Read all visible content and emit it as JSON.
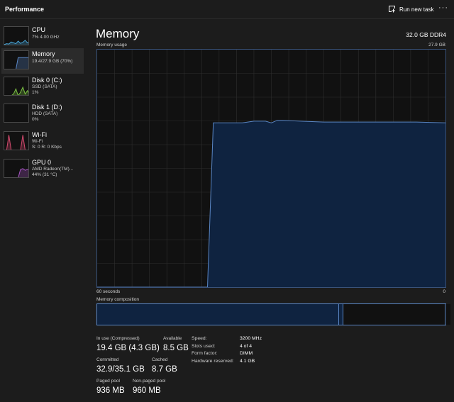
{
  "app": {
    "title": "Performance",
    "run_new_task": "Run new task",
    "more_glyph": "···"
  },
  "sidebar": {
    "items": [
      {
        "id": "cpu",
        "title": "CPU",
        "lines": [
          "7% 4.00 GHz"
        ],
        "color": "#4aa6d8",
        "active": false
      },
      {
        "id": "memory",
        "title": "Memory",
        "lines": [
          "19.4/27.9 GB (70%)"
        ],
        "color": "#5a86c4",
        "active": true
      },
      {
        "id": "disk0",
        "title": "Disk 0 (C:)",
        "lines": [
          "SSD (SATA)",
          "1%"
        ],
        "color": "#7bc043",
        "active": false
      },
      {
        "id": "disk1",
        "title": "Disk 1 (D:)",
        "lines": [
          "HDD (SATA)",
          "0%"
        ],
        "color": "#7bc043",
        "active": false
      },
      {
        "id": "wifi",
        "title": "Wi-Fi",
        "lines": [
          "Wi-Fi",
          "S: 0 R: 0 Kbps"
        ],
        "color": "#d34a6e",
        "active": false
      },
      {
        "id": "gpu0",
        "title": "GPU 0",
        "lines": [
          "AMD Radeon(TM)...",
          "44% (31 °C)"
        ],
        "color": "#a855c4",
        "active": false
      }
    ],
    "sparklines": {
      "cpu": [
        0.05,
        0.1,
        0.08,
        0.2,
        0.15,
        0.1,
        0.25,
        0.12,
        0.18,
        0.3,
        0.15,
        0.22
      ],
      "memory": [
        0,
        0,
        0,
        0,
        0,
        0,
        0.7,
        0.7,
        0.7,
        0.7,
        0.7,
        0.7
      ],
      "disk0": [
        0,
        0,
        0,
        0,
        0.1,
        0.4,
        0,
        0.2,
        0.5,
        0.1,
        0.3,
        0
      ],
      "disk1": [
        0,
        0,
        0,
        0,
        0,
        0,
        0,
        0,
        0,
        0,
        0,
        0
      ],
      "wifi": [
        0,
        0,
        0.9,
        0,
        0,
        0,
        0,
        0,
        0.9,
        0,
        0,
        0
      ],
      "gpu0": [
        0,
        0,
        0,
        0,
        0,
        0,
        0,
        0.5,
        0.55,
        0.45,
        0.5,
        0.5
      ]
    }
  },
  "memory": {
    "heading": "Memory",
    "total_spec": "32.0 GB DDR4",
    "usage_label": "Memory usage",
    "usage_max": "27.9 GB",
    "axis_left": "60 seconds",
    "axis_right": "0",
    "composition_label": "Memory composition",
    "stats": {
      "in_use_label": "In use (Compressed)",
      "in_use_value": "19.4 GB (4.3 GB)",
      "available_label": "Available",
      "available_value": "8.5 GB",
      "committed_label": "Committed",
      "committed_value": "32.9/35.1 GB",
      "cached_label": "Cached",
      "cached_value": "8.7 GB",
      "paged_label": "Paged pool",
      "paged_value": "936 MB",
      "nonpaged_label": "Non-paged pool",
      "nonpaged_value": "960 MB"
    },
    "specs": [
      {
        "key": "Speed:",
        "value": "3200 MHz"
      },
      {
        "key": "Slots used:",
        "value": "4 of 4"
      },
      {
        "key": "Form factor:",
        "value": "DIMM"
      },
      {
        "key": "Hardware reserved:",
        "value": "4.1 GB"
      }
    ]
  },
  "colors": {
    "accent": "#5a86c4",
    "fill": "#0f2340",
    "grid": "#2e2e2e"
  },
  "chart_data": {
    "type": "area",
    "x": [
      60,
      41,
      40,
      35,
      33,
      31,
      30,
      29,
      28,
      25,
      21,
      20,
      15,
      10,
      5,
      0
    ],
    "y": [
      0,
      0,
      19.3,
      19.3,
      19.5,
      19.5,
      19.3,
      19.6,
      19.6,
      19.5,
      19.4,
      19.4,
      19.4,
      19.4,
      19.4,
      19.3
    ],
    "xlim": [
      60,
      0
    ],
    "ylim": [
      0,
      27.9
    ],
    "grid": true,
    "xlabel_left": "60 seconds",
    "xlabel_right": "0",
    "composition": {
      "in_use": 19.4,
      "modified": 0.3,
      "standby": 8.2,
      "free": 0.4,
      "total": 27.9
    }
  }
}
